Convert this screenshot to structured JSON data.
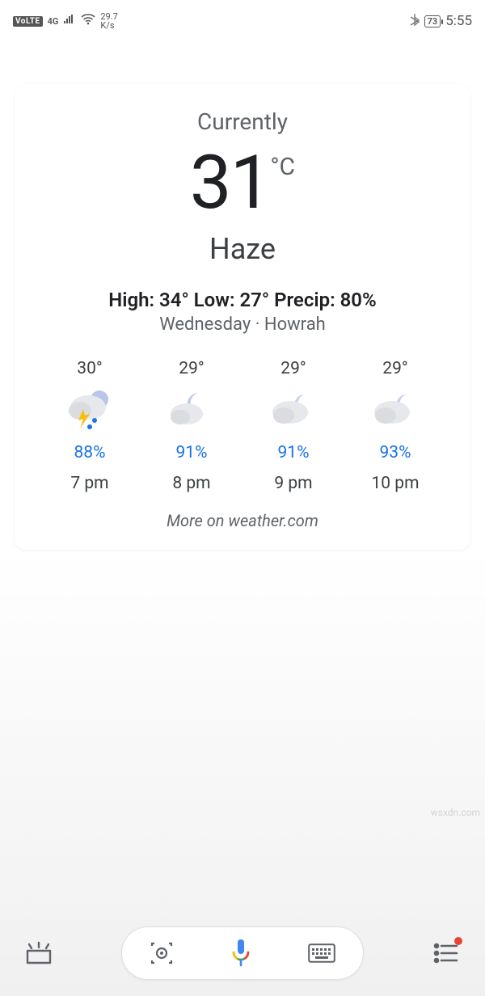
{
  "status": {
    "volte": "VoLTE",
    "net_gen": "4G",
    "rate_top": "29.7",
    "rate_bot": "K/s",
    "battery": "73",
    "time": "5:55"
  },
  "weather": {
    "currently_label": "Currently",
    "temp_value": "31",
    "temp_unit": "°C",
    "condition": "Haze",
    "hilow": "High: 34°  Low: 27°  Precip: 80%",
    "dayloc": "Wednesday · Howrah",
    "hours": [
      {
        "temp": "30°",
        "precip": "88%",
        "time": "7 pm",
        "icon": "storm"
      },
      {
        "temp": "29°",
        "precip": "91%",
        "time": "8 pm",
        "icon": "night-cloud"
      },
      {
        "temp": "29°",
        "precip": "91%",
        "time": "9 pm",
        "icon": "cloud-night"
      },
      {
        "temp": "29°",
        "precip": "93%",
        "time": "10 pm",
        "icon": "cloud-night"
      }
    ],
    "more_label": "More on weather.com"
  },
  "watermark": "wsxdn.com"
}
